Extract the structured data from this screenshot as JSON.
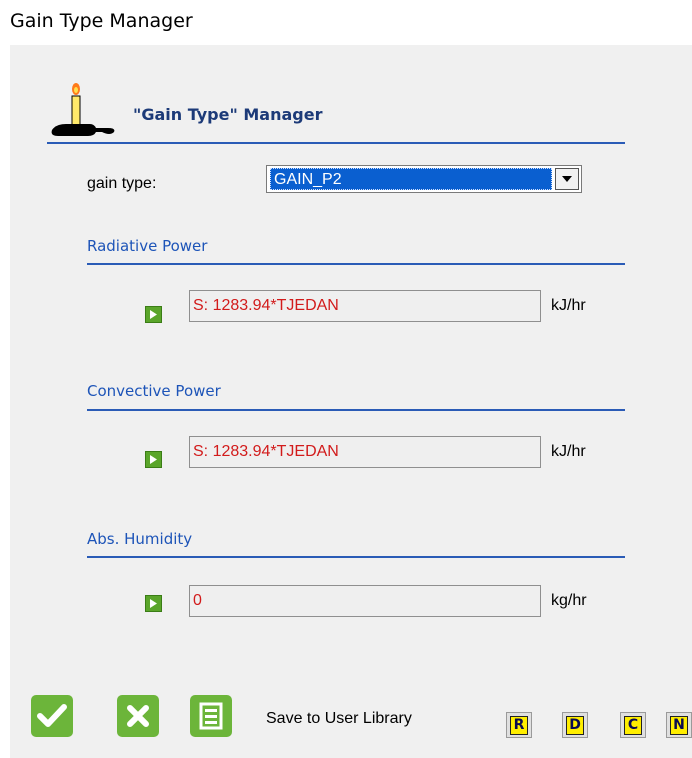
{
  "window": {
    "title": "Gain Type Manager"
  },
  "header": {
    "title": "\"Gain Type\" Manager",
    "logo_icon": "candle-icon"
  },
  "gain_type": {
    "label": "gain type:",
    "selected": "GAIN_P2"
  },
  "sections": [
    {
      "title": "Radiative Power",
      "value": "S: 1283.94*TJEDAN",
      "unit": "kJ/hr"
    },
    {
      "title": "Convective Power",
      "value": "S: 1283.94*TJEDAN",
      "unit": "kJ/hr"
    },
    {
      "title": "Abs. Humidity",
      "value": "0",
      "unit": "kg/hr"
    }
  ],
  "footer": {
    "ok_icon": "checkmark-icon",
    "cancel_icon": "close-icon",
    "save_icon": "save-icon",
    "save_label": "Save to User Library",
    "library_buttons": [
      "R",
      "D",
      "C",
      "N"
    ]
  },
  "colors": {
    "accent_line": "#2a5bb6",
    "section_text": "#1d54b8",
    "value_text": "#d21b1b",
    "button_green": "#6cb53a"
  }
}
